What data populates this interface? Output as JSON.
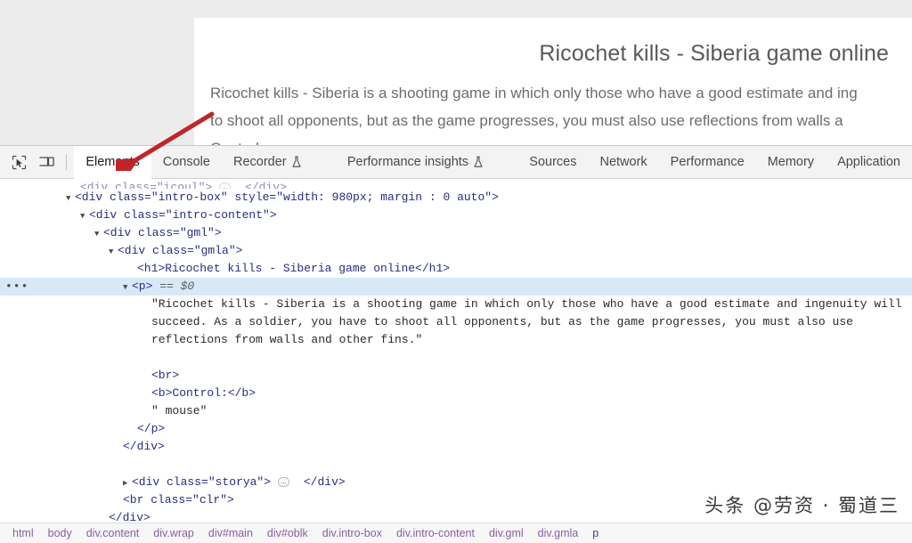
{
  "page": {
    "title": "Ricochet kills - Siberia game online",
    "paragraph_line1": "Ricochet kills - Siberia is a shooting game in which only those who have a good estimate and ing",
    "paragraph_line2": "to shoot all opponents, but as the game progresses, you must also use reflections from walls a",
    "control_line": "Control: mouse"
  },
  "devtools": {
    "toolbar": {
      "inspect_icon": "inspect-element-icon",
      "device_icon": "device-toolbar-icon"
    },
    "tabs": [
      {
        "label": "Elements",
        "active": true,
        "flask": false
      },
      {
        "label": "Console",
        "active": false,
        "flask": false
      },
      {
        "label": "Recorder",
        "active": false,
        "flask": true
      },
      {
        "label": "Performance insights",
        "active": false,
        "flask": true
      },
      {
        "label": "Sources",
        "active": false,
        "flask": false
      },
      {
        "label": "Network",
        "active": false,
        "flask": false
      },
      {
        "label": "Performance",
        "active": false,
        "flask": false
      },
      {
        "label": "Memory",
        "active": false,
        "flask": false
      },
      {
        "label": "Application",
        "active": false,
        "flask": false
      }
    ],
    "dom_rows": [
      {
        "indent": 5,
        "text": "<div class=\"icoul\">",
        "twisty": "",
        "ellipsis": true,
        "tail": "</div>",
        "clipped": true,
        "selected": false
      },
      {
        "indent": 4,
        "text": "<div class=\"intro-box\" style=\"width: 980px; margin : 0 auto\">",
        "twisty": "down",
        "ellipsis": false,
        "tail": "",
        "clipped": false,
        "selected": false
      },
      {
        "indent": 5,
        "text": "<div class=\"intro-content\">",
        "twisty": "down",
        "ellipsis": false,
        "tail": "",
        "clipped": false,
        "selected": false
      },
      {
        "indent": 6,
        "text": "<div class=\"gml\">",
        "twisty": "down",
        "ellipsis": false,
        "tail": "",
        "clipped": false,
        "selected": false
      },
      {
        "indent": 7,
        "text": "<div class=\"gmla\">",
        "twisty": "down",
        "ellipsis": false,
        "tail": "",
        "clipped": false,
        "selected": false
      },
      {
        "indent": 9,
        "text": "<h1>Ricochet kills - Siberia game online</h1>",
        "twisty": "",
        "ellipsis": false,
        "tail": "",
        "clipped": false,
        "selected": false
      },
      {
        "indent": 8,
        "text": "<p>",
        "twisty": "down",
        "ellipsis": false,
        "tail": "== $0",
        "clipped": false,
        "selected": true
      },
      {
        "indent": 10,
        "text": "\"Ricochet kills - Siberia is a shooting game in which only those who have a good estimate and ingenuity will",
        "twisty": "",
        "ellipsis": false,
        "tail": "",
        "clipped": false,
        "selected": false,
        "plain": true
      },
      {
        "indent": 10,
        "text": "succeed. As a soldier, you have to shoot all opponents, but as the game progresses, you must also use",
        "twisty": "",
        "ellipsis": false,
        "tail": "",
        "clipped": false,
        "selected": false,
        "plain": true
      },
      {
        "indent": 10,
        "text": "reflections from walls and other fins.\"",
        "twisty": "",
        "ellipsis": false,
        "tail": "",
        "clipped": false,
        "selected": false,
        "plain": true
      },
      {
        "indent": 10,
        "text": "",
        "twisty": "",
        "ellipsis": false,
        "tail": "",
        "clipped": false,
        "selected": false,
        "spacer": true
      },
      {
        "indent": 10,
        "text": "<br>",
        "twisty": "",
        "ellipsis": false,
        "tail": "",
        "clipped": false,
        "selected": false
      },
      {
        "indent": 10,
        "text": "<b>Control:</b>",
        "twisty": "",
        "ellipsis": false,
        "tail": "",
        "clipped": false,
        "selected": false
      },
      {
        "indent": 10,
        "text": "\" mouse\"",
        "twisty": "",
        "ellipsis": false,
        "tail": "",
        "clipped": false,
        "selected": false,
        "plain": true
      },
      {
        "indent": 9,
        "text": "</p>",
        "twisty": "",
        "ellipsis": false,
        "tail": "",
        "clipped": false,
        "selected": false
      },
      {
        "indent": 8,
        "text": "</div>",
        "twisty": "",
        "ellipsis": false,
        "tail": "",
        "clipped": false,
        "selected": false
      },
      {
        "indent": 10,
        "text": "",
        "twisty": "",
        "ellipsis": false,
        "tail": "",
        "clipped": false,
        "selected": false,
        "spacer": true
      },
      {
        "indent": 8,
        "text": "<div class=\"storya\">",
        "twisty": "right",
        "ellipsis": true,
        "tail": "</div>",
        "clipped": false,
        "selected": false
      },
      {
        "indent": 8,
        "text": "<br class=\"clr\">",
        "twisty": "",
        "ellipsis": false,
        "tail": "",
        "clipped": false,
        "selected": false
      },
      {
        "indent": 7,
        "text": "</div>",
        "twisty": "",
        "ellipsis": false,
        "tail": "",
        "clipped": false,
        "selected": false
      },
      {
        "indent": 6,
        "text": "</div>",
        "twisty": "",
        "ellipsis": false,
        "tail": "",
        "clipped": false,
        "selected": false
      }
    ],
    "breadcrumb": [
      {
        "label": "html",
        "active": false
      },
      {
        "label": "body",
        "active": false
      },
      {
        "label": "div.content",
        "active": false
      },
      {
        "label": "div.wrap",
        "active": false
      },
      {
        "label": "div#main",
        "active": false
      },
      {
        "label": "div#oblk",
        "active": false
      },
      {
        "label": "div.intro-box",
        "active": false
      },
      {
        "label": "div.intro-content",
        "active": false
      },
      {
        "label": "div.gml",
        "active": false
      },
      {
        "label": "div.gmla",
        "active": false
      },
      {
        "label": "p",
        "active": true
      }
    ]
  },
  "annotation": {
    "arrow_color": "#c0252a",
    "arrow_target": "Elements"
  },
  "watermark": {
    "text": "头条 @劳资 · 蜀道三"
  }
}
